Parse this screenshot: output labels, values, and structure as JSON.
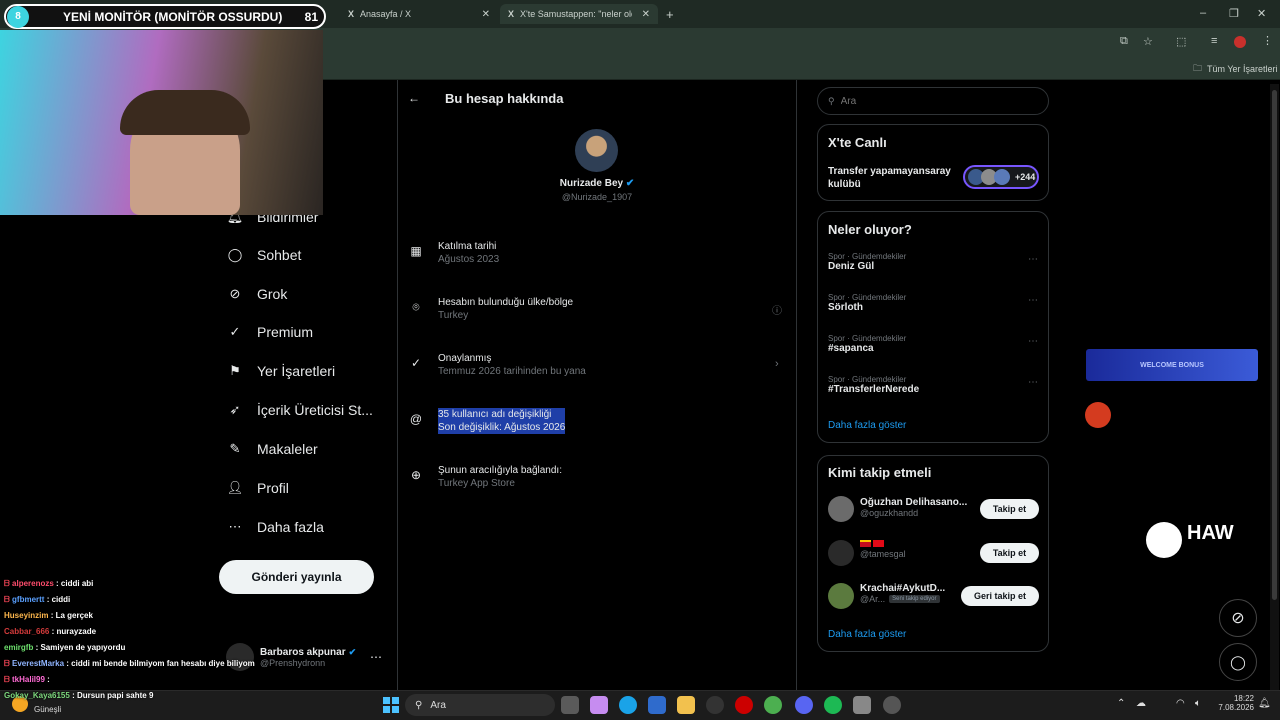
{
  "stream_overlay": {
    "badge_number": "8",
    "title": "YENİ MONİTÖR (MONİTÖR OSSURDU)",
    "count": "81"
  },
  "tabs": [
    {
      "label": "Anasayfa / X"
    },
    {
      "label": "X'te Samustappen: \"neler oldu !"
    }
  ],
  "bookmarks": {
    "all_bookmarks": "Tüm Yer İşaretleri"
  },
  "nav": {
    "items": [
      {
        "label": "Bildirimler"
      },
      {
        "label": "Sohbet"
      },
      {
        "label": "Grok"
      },
      {
        "label": "Premium"
      },
      {
        "label": "Yer İşaretleri"
      },
      {
        "label": "İçerik Üreticisi St..."
      },
      {
        "label": "Makaleler"
      },
      {
        "label": "Profil"
      },
      {
        "label": "Daha fazla"
      }
    ],
    "post_button": "Gönderi yayınla",
    "account": {
      "name": "Barbaros akpunar",
      "handle": "@Prenshydronn"
    }
  },
  "main": {
    "header": "Bu hesap hakkında",
    "profile": {
      "name": "Nurizade Bey",
      "handle": "@Nurizade_1907"
    },
    "rows": [
      {
        "title": "Katılma tarihi",
        "sub": "Ağustos 2023"
      },
      {
        "title": "Hesabın bulunduğu ülke/bölge",
        "sub": "Turkey"
      },
      {
        "title": "Onaylanmış",
        "sub": "Temmuz 2026 tarihinden bu yana"
      },
      {
        "title": "35 kullanıcı adı değişikliği",
        "sub": "Son değişiklik: Ağustos 2026"
      },
      {
        "title": "Şunun aracılığıyla bağlandı:",
        "sub": "Turkey App Store"
      }
    ]
  },
  "right": {
    "search_placeholder": "Ara",
    "live": {
      "title": "X'te Canlı",
      "event": "Transfer yapamayansaray kulübü",
      "count": "+244"
    },
    "trends": {
      "title": "Neler oluyor?",
      "items": [
        {
          "meta": "Spor · Gündemdekiler",
          "name": "Deniz Gül"
        },
        {
          "meta": "Spor · Gündemdekiler",
          "name": "Sörloth"
        },
        {
          "meta": "Spor · Gündemdekiler",
          "name": "#sapanca"
        },
        {
          "meta": "Spor · Gündemdekiler",
          "name": "#TransferlerNerede"
        }
      ],
      "more": "Daha fazla göster"
    },
    "follow": {
      "title": "Kimi takip etmeli",
      "items": [
        {
          "name": "Oğuzhan Delihasano...",
          "handle": "@oguzkhandd",
          "button": "Takip et",
          "note": ""
        },
        {
          "name": "",
          "handle": "@tamesgal",
          "button": "Takip et",
          "note": ""
        },
        {
          "name": "Krachai#AykutD...",
          "handle": "@Ar...",
          "button": "Geri takip et",
          "note": "Seni takip ediyor"
        }
      ],
      "more": "Daha fazla göster"
    }
  },
  "ads": {
    "banner": "WELCOME BONUS"
  },
  "chat": [
    {
      "user": "alperenozs",
      "msg": ": ciddi abi",
      "color": "#ff4d6d"
    },
    {
      "user": "gfbmertt",
      "msg": ": ciddi",
      "color": "#5aa0ff"
    },
    {
      "user": "Huseyinzim",
      "msg": ": La gerçek",
      "color": "#ffb84d"
    },
    {
      "user": "Cabbar_666",
      "msg": ": nurayzade",
      "color": "#d43b3b"
    },
    {
      "user": "emirgfb",
      "msg": ": Samiyen de yapıyordu",
      "color": "#6de06d"
    },
    {
      "user": "EverestMarka",
      "msg": ": ciddi mi bende bilmiyom fan hesabı diye biliyom",
      "color": "#8fb4ff"
    },
    {
      "user": "tkHalil99",
      "msg": ":",
      "color": "#ff6ad5"
    },
    {
      "user": "Gokay_Kaya6155",
      "msg": ": Dursun papi sahte 9",
      "color": "#7dd87d"
    }
  ],
  "taskbar": {
    "search": "Ara",
    "weather": "Güneşli",
    "time": "18:22",
    "date": "7.08.2026"
  }
}
